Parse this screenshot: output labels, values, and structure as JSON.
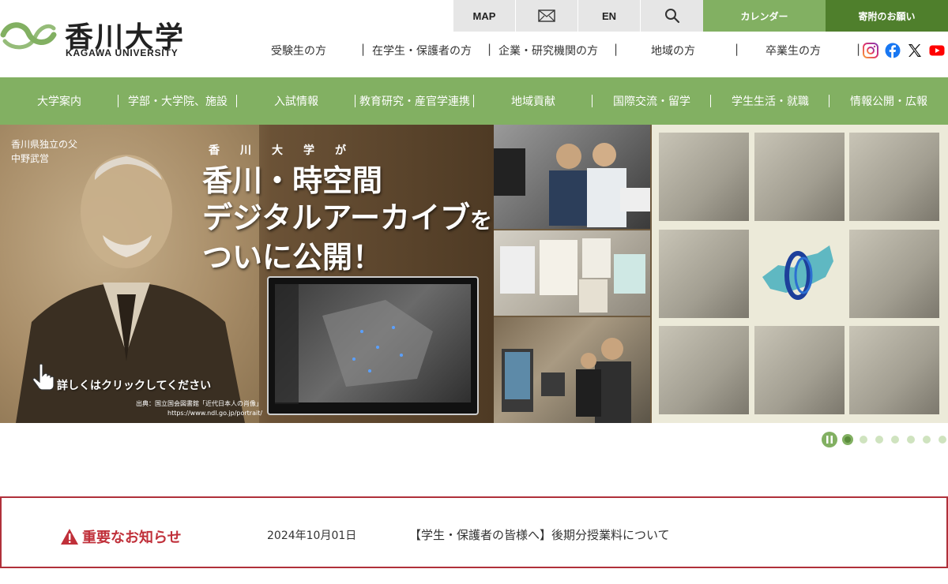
{
  "logo": {
    "name_jp": "香川大学",
    "name_en": "KAGAWA UNIVERSITY",
    "mark": "kagawa-mark-icon",
    "color": "#82b062"
  },
  "utility": {
    "map": "MAP",
    "mail_icon": "mail-icon",
    "en": "EN",
    "search_icon": "search-icon",
    "calendar": "カレンダー",
    "donation": "寄附のお願い"
  },
  "audience": [
    "受験生の方",
    "在学生・保護者の方",
    "企業・研究機関の方",
    "地域の方",
    "卒業生の方"
  ],
  "social": [
    "instagram-icon",
    "facebook-icon",
    "x-icon",
    "youtube-icon"
  ],
  "nav": [
    "大学案内",
    "学部・大学院、施設",
    "入試情報",
    "教育研究・産官学連携",
    "地域貢献",
    "国際交流・留学",
    "学生生活・就職",
    "情報公開・広報"
  ],
  "hero": {
    "portrait_caption_1": "香川県独立の父",
    "portrait_caption_2": "中野武営",
    "eyebrow": "香川大学が",
    "headline_1": "香川・時空間",
    "headline_2": "デジタルアーカイブ",
    "headline_2b": "を",
    "headline_3": "ついに公開！",
    "cta": "詳しくはクリックしてください",
    "credit_1": "出典：国立国会図書館「近代日本人の肖像」",
    "credit_2": "https://www.ndl.go.jp/portrait/"
  },
  "carousel": {
    "pause_icon": "pause-icon",
    "slide_count": 7,
    "active_index": 0
  },
  "notice": {
    "label": "重要なお知らせ",
    "icon": "warning-icon",
    "date": "2024年10月01日",
    "title": "【学生・保護者の皆様へ】後期分授業料について"
  },
  "colors": {
    "green": "#82b062",
    "dark_green": "#4f7f2c",
    "red": "#c0303a",
    "gray": "#e6e6e6"
  }
}
